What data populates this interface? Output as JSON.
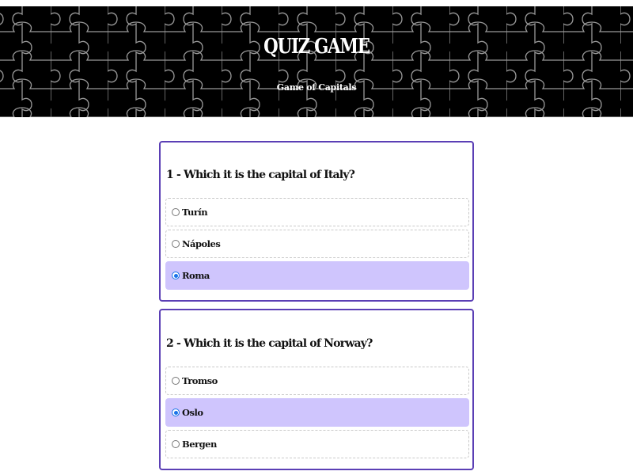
{
  "header": {
    "title": "QUIZ GAME",
    "subtitle": "Game of Capitals"
  },
  "questions": [
    {
      "text": "1 - Which it is the capital of Italy?",
      "options": [
        {
          "label": "Turín",
          "selected": false
        },
        {
          "label": "Nápoles",
          "selected": false
        },
        {
          "label": "Roma",
          "selected": true
        }
      ]
    },
    {
      "text": "2 - Which it is the capital of Norway?",
      "options": [
        {
          "label": "Tromso",
          "selected": false
        },
        {
          "label": "Oslo",
          "selected": true
        },
        {
          "label": "Bergen",
          "selected": false
        }
      ]
    }
  ],
  "colors": {
    "header_bg": "#000000",
    "card_border": "#5b3fb5",
    "selected_bg": "#cfc5fd",
    "radio_checked": "#1a73e8"
  }
}
